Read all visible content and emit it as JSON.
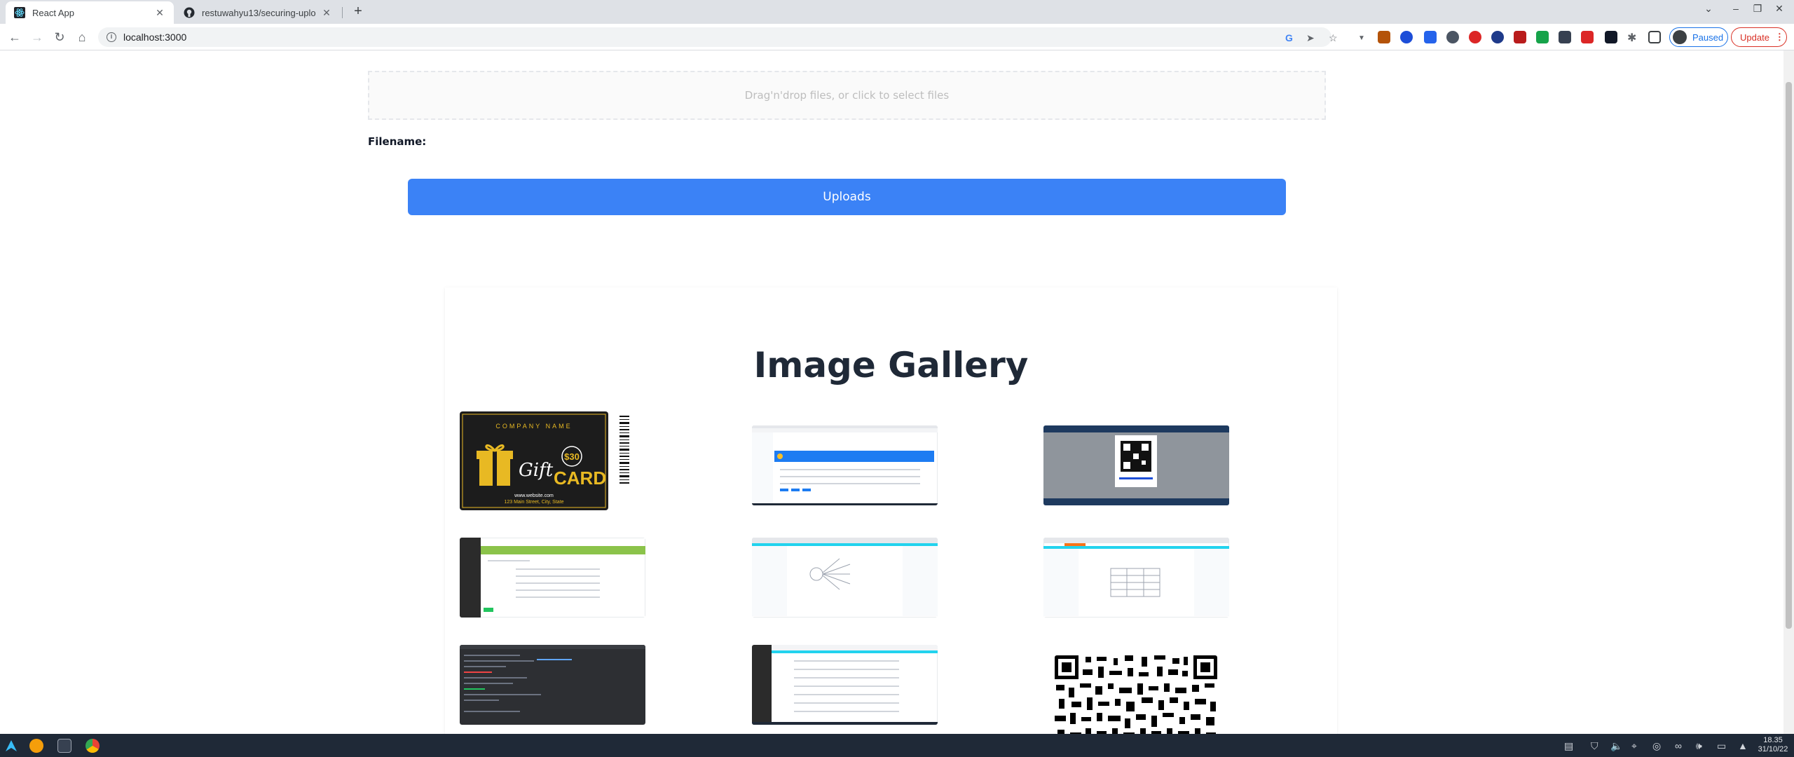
{
  "browser": {
    "tabs": [
      {
        "title": "React App",
        "active": true
      },
      {
        "title": "restuwahyu13/securing-uplo",
        "active": false
      }
    ],
    "address": "localhost:3000",
    "profile_label": "Paused",
    "update_label": "Update"
  },
  "page": {
    "dropzone_text": "Drag'n'drop files, or click to select files",
    "filename_label": "Filename:",
    "upload_button": "Uploads",
    "gallery_title": "Image Gallery",
    "gift_card": {
      "company": "COMPANY NAME",
      "gift_word": "Gift",
      "card_word": "CARD",
      "amount": "$30",
      "website": "www.website.com",
      "address": "123 Main Street, City, State"
    },
    "gallery_images": [
      "gift-card",
      "dashboard-screenshot",
      "qr-screenshot",
      "form-screenshot",
      "diagram-screenshot",
      "table-screenshot",
      "terminal-screenshot",
      "settings-screenshot",
      "qr-code"
    ]
  },
  "taskbar": {
    "time": "18.35",
    "date": "31/10/22"
  },
  "colors": {
    "accent": "#3b82f6",
    "chrome": "#dee1e6",
    "taskbar": "#1f2937"
  }
}
